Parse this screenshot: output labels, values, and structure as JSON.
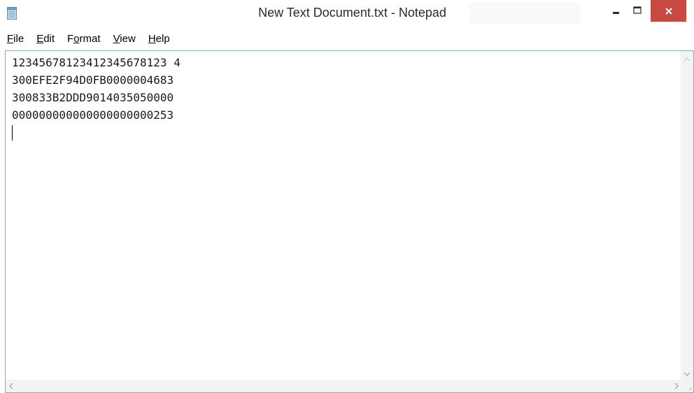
{
  "window": {
    "title": "New Text Document.txt - Notepad",
    "icon": "notepad-icon",
    "close_color": "#c7493f"
  },
  "controls": {
    "minimize_icon": "minimize-icon",
    "maximize_icon": "maximize-icon",
    "close_icon": "close-icon"
  },
  "menu": {
    "items": [
      {
        "label": "File",
        "underline": "F"
      },
      {
        "label": "Edit",
        "underline": "E"
      },
      {
        "label": "Format",
        "underline": "o"
      },
      {
        "label": "View",
        "underline": "V"
      },
      {
        "label": "Help",
        "underline": "H"
      }
    ]
  },
  "document": {
    "lines": [
      "12345678123412345678123 4",
      "300EFE2F94D0FB0000004683",
      "300833B2DDD9014035050000",
      "000000000000000000000253"
    ]
  },
  "colors": {
    "editor_border": "#8aa6c1",
    "scrollbar": "#f3f3f3"
  }
}
